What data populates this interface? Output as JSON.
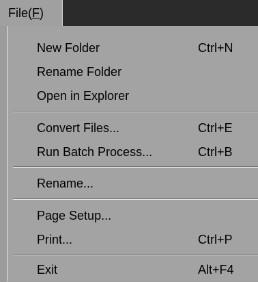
{
  "menubar": {
    "file_label": "File(",
    "file_accel": "F",
    "file_close": ")"
  },
  "menu": {
    "items": [
      {
        "label": "New Folder",
        "shortcut": "Ctrl+N"
      },
      {
        "label": "Rename Folder",
        "shortcut": ""
      },
      {
        "label": "Open in Explorer",
        "shortcut": ""
      },
      {
        "label": "Convert Files...",
        "shortcut": "Ctrl+E"
      },
      {
        "label": "Run Batch Process...",
        "shortcut": "Ctrl+B"
      },
      {
        "label": "Rename...",
        "shortcut": ""
      },
      {
        "label": "Page Setup...",
        "shortcut": ""
      },
      {
        "label": "Print...",
        "shortcut": "Ctrl+P"
      },
      {
        "label": "Exit",
        "shortcut": "Alt+F4"
      }
    ]
  }
}
